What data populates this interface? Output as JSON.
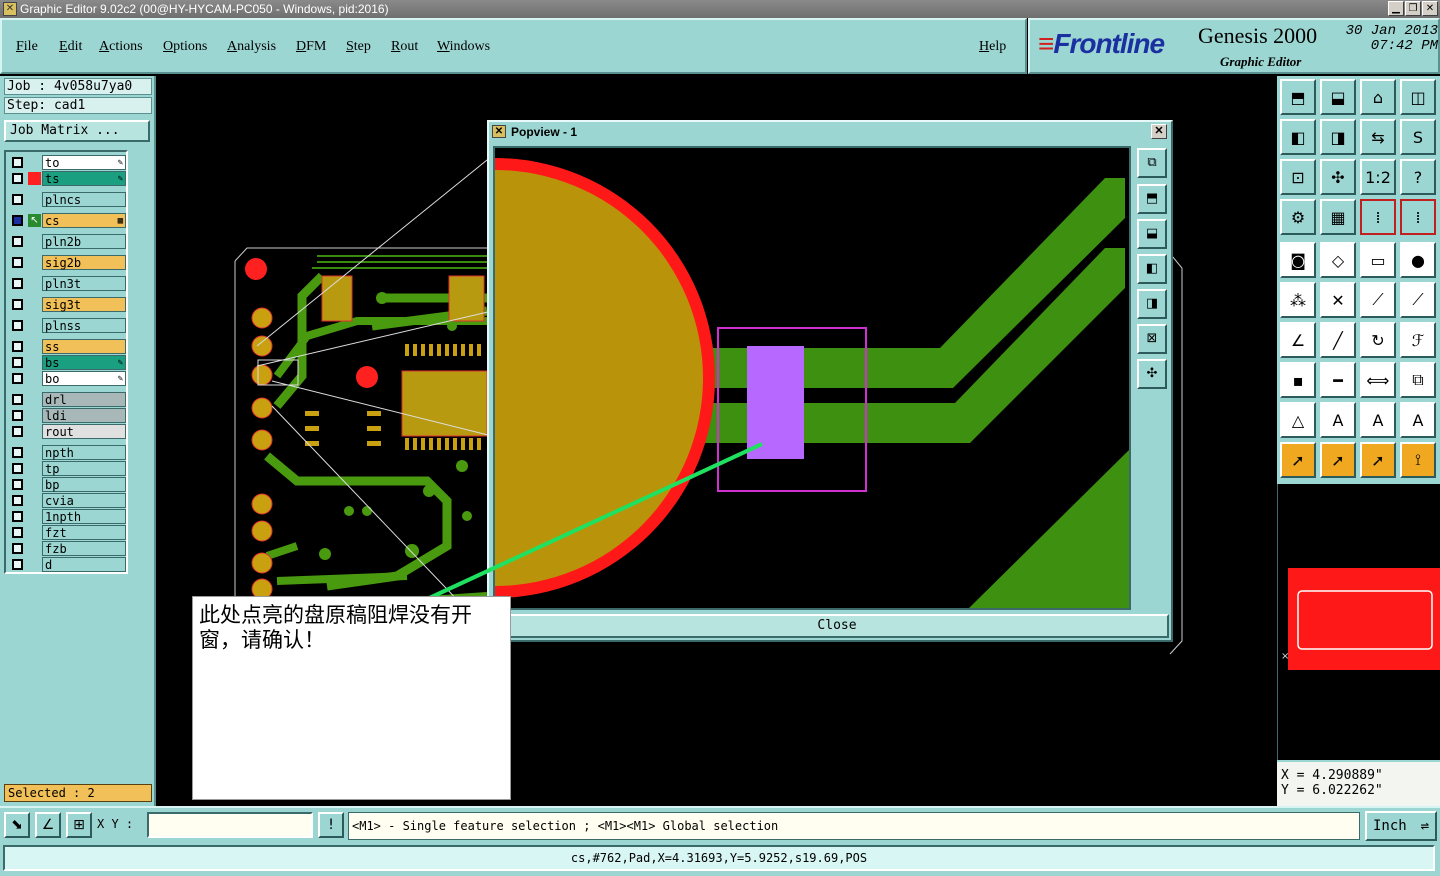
{
  "window": {
    "title": "Graphic Editor 9.02c2 (00@HY-HYCAM-PC050 - Windows, pid:2016)"
  },
  "menu": [
    "File",
    "Edit",
    "Actions",
    "Options",
    "Analysis",
    "DFM",
    "Step",
    "Rout",
    "Windows"
  ],
  "help_label": "Help",
  "brand": {
    "logo": "Frontline",
    "product": "Genesis 2000",
    "subtitle": "Graphic Editor",
    "date": "30 Jan 2013",
    "time": "07:42 PM"
  },
  "job": {
    "job_label": "Job : 4v058u7ya0",
    "step_label": "Step: cad1",
    "matrix_label": "Job Matrix ..."
  },
  "layers": [
    {
      "name": "to",
      "color": "#ffffff",
      "mark": "",
      "flag": "pencil-icon"
    },
    {
      "name": "ts",
      "color": "#1aa080",
      "mark": "#ff2020",
      "flag": "pencil-icon"
    },
    {
      "name": "plncs",
      "color": "#9cd6d2",
      "mark": "",
      "flag": ""
    },
    {
      "name": "cs",
      "color": "#f2c058",
      "mark": "cursor",
      "flag": "grid-icon"
    },
    {
      "name": "pln2b",
      "color": "#9cd6d2",
      "mark": "",
      "flag": ""
    },
    {
      "name": "sig2b",
      "color": "#f2c058",
      "mark": "",
      "flag": ""
    },
    {
      "name": "pln3t",
      "color": "#9cd6d2",
      "mark": "",
      "flag": ""
    },
    {
      "name": "sig3t",
      "color": "#f2c058",
      "mark": "",
      "flag": ""
    },
    {
      "name": "plnss",
      "color": "#9cd6d2",
      "mark": "",
      "flag": ""
    },
    {
      "name": "ss",
      "color": "#f2c058",
      "mark": "",
      "flag": ""
    },
    {
      "name": "bs",
      "color": "#1aa080",
      "mark": "",
      "flag": "pencil-icon"
    },
    {
      "name": "bo",
      "color": "#ffffff",
      "mark": "",
      "flag": "pencil-icon"
    },
    {
      "name": "drl",
      "color": "#a8b8b8",
      "mark": "",
      "flag": ""
    },
    {
      "name": "ldi",
      "color": "#a8b8b8",
      "mark": "",
      "flag": ""
    },
    {
      "name": "rout",
      "color": "#e0e0e0",
      "mark": "",
      "flag": ""
    },
    {
      "name": "npth",
      "color": "#9cd6d2",
      "mark": "",
      "flag": ""
    },
    {
      "name": "tp",
      "color": "#9cd6d2",
      "mark": "",
      "flag": ""
    },
    {
      "name": "bp",
      "color": "#9cd6d2",
      "mark": "",
      "flag": ""
    },
    {
      "name": "cvia",
      "color": "#9cd6d2",
      "mark": "",
      "flag": ""
    },
    {
      "name": "1npth",
      "color": "#9cd6d2",
      "mark": "",
      "flag": ""
    },
    {
      "name": "fzt",
      "color": "#9cd6d2",
      "mark": "",
      "flag": ""
    },
    {
      "name": "fzb",
      "color": "#9cd6d2",
      "mark": "",
      "flag": ""
    },
    {
      "name": "d",
      "color": "#9cd6d2",
      "mark": "",
      "flag": ""
    }
  ],
  "selected_label": "Selected : 2",
  "popview": {
    "title": "Popview - 1",
    "close_label": "Close"
  },
  "note": "此处点亮的盘原稿阻焊没有开窗，请确认！",
  "toolbar_icons": [
    "home-up-icon",
    "home-down-icon",
    "home-icon",
    "split-window-icon",
    "pan-left-icon",
    "pan-right-icon",
    "flip-icon",
    "s-route-icon",
    "zoom-fit-icon",
    "zoom-center-icon",
    "scale-1-2-icon",
    "help-question-icon",
    "settings-tool-icon",
    "grid-icon",
    "snap-red-icon",
    "snap-red-2-icon",
    "pad-select-icon",
    "rotate-rect-icon",
    "ruler-icon",
    "dot-icon",
    "connect-nodes-icon",
    "cross-node-icon",
    "line-node-icon",
    "line-node-2-icon",
    "angle-line-icon",
    "slash-line-icon",
    "arc-icon",
    "three-f-icon",
    "square-dot-icon",
    "dash-line-icon",
    "dimension-icon",
    "blocks-icon",
    "triangle-a-icon",
    "triangle-a-2-icon",
    "triangle-a-3-icon",
    "triangle-a-4-icon",
    "select-arrow-icon",
    "select-arrow-2-icon",
    "select-arrow-3-icon",
    "select-path-icon"
  ],
  "coords": {
    "x": "X = 4.290889\"",
    "y": "Y = 6.022262\""
  },
  "xy_label": "X Y :",
  "xy_value": "",
  "prompt": "<M1> - Single feature selection ; <M1><M1> Global selection",
  "unit": "Inch",
  "status": "cs,#762,Pad,X=4.31693,Y=5.9252,s19.69,POS"
}
